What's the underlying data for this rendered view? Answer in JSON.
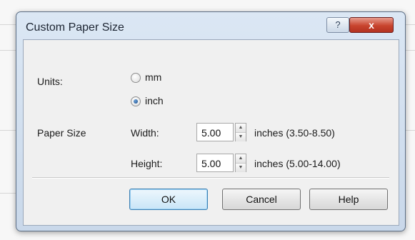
{
  "dialog": {
    "title": "Custom Paper Size",
    "help_glyph": "?",
    "close_glyph": "x"
  },
  "units": {
    "label": "Units:",
    "options": [
      {
        "label": "mm",
        "selected": false
      },
      {
        "label": "inch",
        "selected": true
      }
    ]
  },
  "paper_size": {
    "label": "Paper Size",
    "width": {
      "label": "Width:",
      "value": "5.00",
      "range_text": "inches (3.50-8.50)"
    },
    "height": {
      "label": "Height:",
      "value": "5.00",
      "range_text": "inches (5.00-14.00)"
    }
  },
  "buttons": {
    "ok": "OK",
    "cancel": "Cancel",
    "help": "Help"
  },
  "spinner": {
    "up_glyph": "▲",
    "down_glyph": "▼"
  },
  "colors": {
    "close_button": "#c8442e",
    "default_button_border": "#3c7fb1",
    "title_bar": "#dbe7f4"
  }
}
